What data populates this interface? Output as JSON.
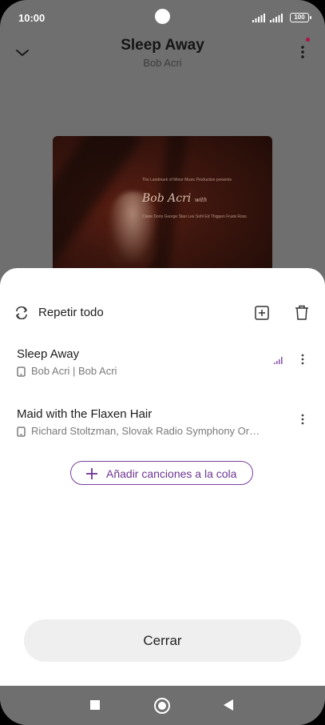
{
  "status_bar": {
    "time": "10:00",
    "battery": "100"
  },
  "now_playing": {
    "title": "Sleep Away",
    "artist": "Bob Acri"
  },
  "album_art": {
    "small_text": "The Landmark of Minor Music Production presents",
    "big_text": "Bob Acri",
    "big_suffix": "with",
    "names": "Claire Doris George Stan Lee Sohl Ed Thigpen Frank Ross"
  },
  "queue_sheet": {
    "repeat_label": "Repetir todo",
    "items": [
      {
        "title": "Sleep Away",
        "subtitle": "Bob Acri | Bob Acri",
        "playing": true
      },
      {
        "title": "Maid with the Flaxen Hair",
        "subtitle": "Richard Stoltzman, Slovak Radio Symphony Or…",
        "playing": false
      }
    ],
    "add_button_label": "Añadir canciones a la cola",
    "close_button_label": "Cerrar"
  },
  "colors": {
    "accent": "#6d3591",
    "dim_overlay": "#6f6f6f",
    "notification": "#b0124a"
  }
}
